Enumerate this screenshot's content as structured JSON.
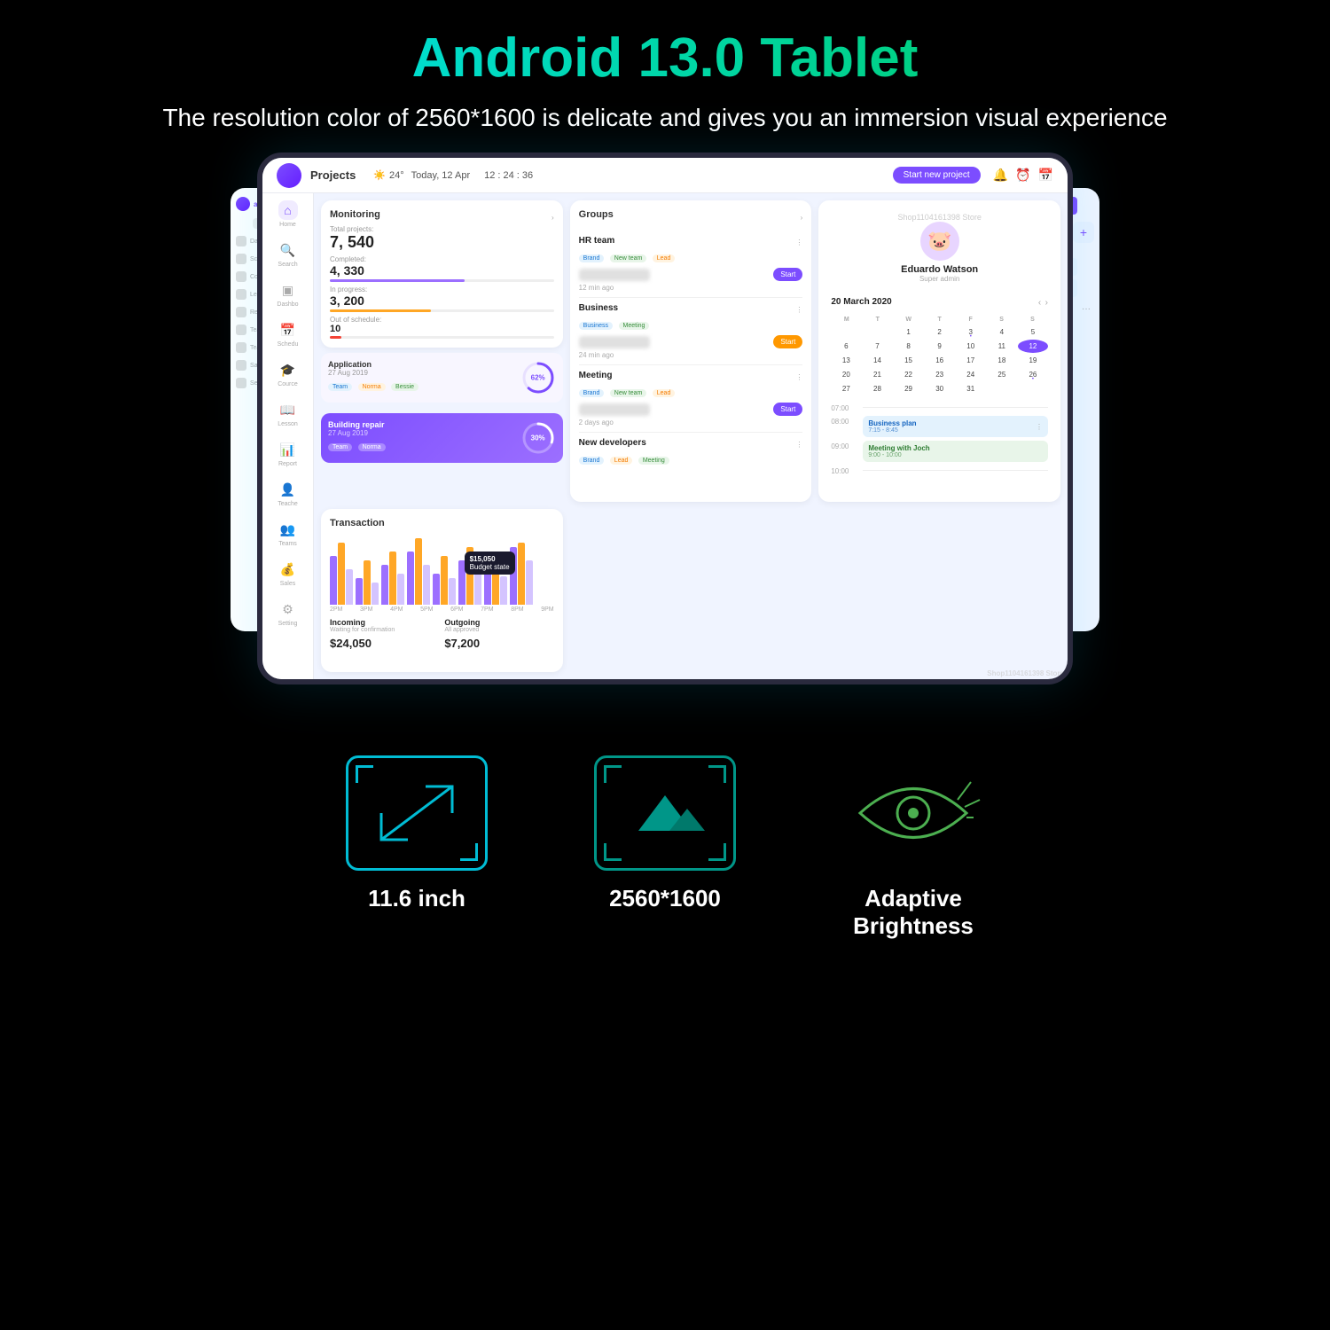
{
  "page": {
    "title": "Android 13.0 Tablet",
    "subtitle": "The resolution color of 2560*1600 is delicate and gives you an immersion visual experience"
  },
  "header": {
    "logo_text": "",
    "page_title": "Projects",
    "weather": "24°",
    "date": "Today, 12 Apr",
    "time": "12 : 24 : 36",
    "cta_button": "Start new project",
    "store_label": "Shop1104161398 Store"
  },
  "sidebar": {
    "items": [
      {
        "label": "Home",
        "icon": "⌂"
      },
      {
        "label": "Search",
        "icon": "🔍"
      },
      {
        "label": "Dashbo",
        "icon": "▣"
      },
      {
        "label": "Schedu",
        "icon": "📅"
      },
      {
        "label": "Cource",
        "icon": "🎓"
      },
      {
        "label": "Lesson",
        "icon": "📖"
      },
      {
        "label": "Report",
        "icon": "📊"
      },
      {
        "label": "Teache",
        "icon": "👤"
      },
      {
        "label": "Teams",
        "icon": "👥"
      },
      {
        "label": "Sales",
        "icon": "💰"
      },
      {
        "label": "Setting",
        "icon": "⚙"
      }
    ]
  },
  "monitoring": {
    "title": "Monitoring",
    "total_projects_label": "Total projects:",
    "total_projects": "7, 540",
    "completed_label": "Completed:",
    "completed": "4, 330",
    "in_progress_label": "In progress:",
    "in_progress": "3, 200",
    "out_of_schedule_label": "Out of schedule:",
    "out_of_schedule": "10"
  },
  "application_card1": {
    "title": "Application",
    "date": "27 Aug 2019",
    "percentage": "62%",
    "tags": [
      "Team",
      "Norma",
      "Bessie"
    ]
  },
  "application_card2": {
    "title": "Building repair",
    "date": "27 Aug 2019",
    "percentage": "30%",
    "tags": [
      "Team",
      "Norma"
    ]
  },
  "groups": {
    "title": "Groups",
    "items": [
      {
        "name": "HR team",
        "tags": [
          "Brand",
          "New team",
          "Lead"
        ],
        "time": "12 min ago",
        "btn": "Start"
      },
      {
        "name": "Business",
        "tags": [
          "Business",
          "Meeting"
        ],
        "time": "24 min ago",
        "btn": "Start"
      },
      {
        "name": "Meeting",
        "tags": [
          "Brand",
          "New team",
          "Lead"
        ],
        "time": "2 days ago",
        "btn": "Start"
      },
      {
        "name": "New developers",
        "tags": [
          "Brand",
          "Lead",
          "Meeting"
        ],
        "time": "",
        "btn": ""
      }
    ]
  },
  "profile": {
    "name": "Eduardo Watson",
    "role": "Super admin",
    "avatar_emoji": "🐷",
    "store": "Shop1104161398 Store"
  },
  "calendar": {
    "month": "20 March 2020",
    "day_names": [
      "M",
      "T",
      "W",
      "T",
      "F",
      "S",
      "S"
    ],
    "days": [
      {
        "d": "",
        "empty": true
      },
      {
        "d": "",
        "empty": true
      },
      {
        "d": "1"
      },
      {
        "d": "2"
      },
      {
        "d": "3",
        "dot": true
      },
      {
        "d": "4"
      },
      {
        "d": "5"
      },
      {
        "d": "6"
      },
      {
        "d": "7"
      },
      {
        "d": "8"
      },
      {
        "d": "9"
      },
      {
        "d": "10"
      },
      {
        "d": "11"
      },
      {
        "d": "12"
      },
      {
        "d": "13"
      },
      {
        "d": "14"
      },
      {
        "d": "15"
      },
      {
        "d": "16"
      },
      {
        "d": "17"
      },
      {
        "d": "18"
      },
      {
        "d": "19"
      },
      {
        "d": "20"
      },
      {
        "d": "21"
      },
      {
        "d": "22"
      },
      {
        "d": "23"
      },
      {
        "d": "24"
      },
      {
        "d": "25"
      },
      {
        "d": "26",
        "dot": true
      },
      {
        "d": "27"
      },
      {
        "d": "28"
      },
      {
        "d": "29"
      },
      {
        "d": "30"
      },
      {
        "d": "31"
      }
    ],
    "events": [
      {
        "time": "07:00",
        "title": "",
        "empty": true
      },
      {
        "time": "08:00",
        "title": "Business plan",
        "time_range": "7:15 - 8:45",
        "color": "blue"
      },
      {
        "time": "09:00",
        "title": "Meeting with Joch",
        "time_range": "9:00 - 10:00",
        "color": "green"
      },
      {
        "time": "10:00",
        "title": "",
        "empty": true
      }
    ]
  },
  "transaction": {
    "title": "Transaction",
    "tooltip_value": "$15,050",
    "tooltip_label": "Budget state",
    "bars": [
      {
        "h1": 55,
        "h2": 70,
        "h3": 40
      },
      {
        "h1": 30,
        "h2": 50,
        "h3": 25
      },
      {
        "h1": 45,
        "h2": 60,
        "h3": 35
      },
      {
        "h1": 60,
        "h2": 75,
        "h3": 45
      },
      {
        "h1": 35,
        "h2": 55,
        "h3": 30
      },
      {
        "h1": 50,
        "h2": 65,
        "h3": 40
      },
      {
        "h1": 40,
        "h2": 58,
        "h3": 32
      },
      {
        "h1": 65,
        "h2": 70,
        "h3": 50
      }
    ],
    "x_labels": [
      "2PM",
      "3PM",
      "4PM",
      "5PM",
      "6PM",
      "7PM",
      "8PM",
      "9PM"
    ]
  },
  "finance": {
    "incoming_label": "Incoming",
    "incoming_sub": "Waiting for confirmation",
    "incoming_value": "$24,050",
    "outgoing_label": "Outgoing",
    "outgoing_sub": "All approved",
    "outgoing_value": "$7,200"
  },
  "features": [
    {
      "icon_type": "arrow",
      "label": "11.6 inch",
      "color": "cyan"
    },
    {
      "icon_type": "mountain",
      "label": "2560*1600",
      "color": "teal"
    },
    {
      "icon_type": "eye",
      "label": "Adaptive\nBrightness",
      "color": "green"
    }
  ]
}
